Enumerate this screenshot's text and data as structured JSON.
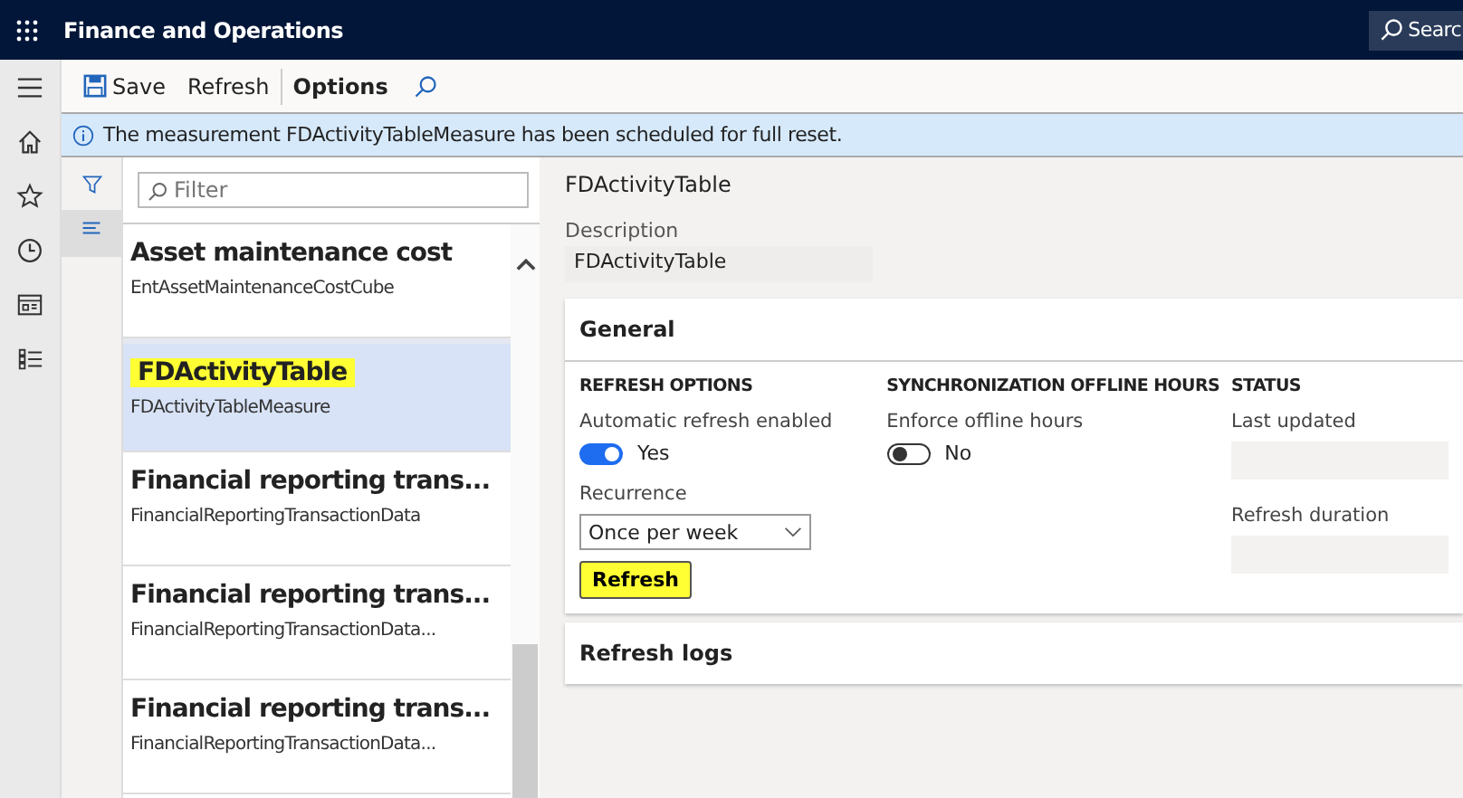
{
  "app": {
    "title": "Finance and Operations",
    "search": "Searc"
  },
  "toolbar": [
    {
      "label": "Save",
      "kind": "save"
    },
    {
      "label": "Refresh",
      "kind": "plain"
    },
    {
      "label": "Options",
      "kind": "bold"
    },
    {
      "kind": "search"
    }
  ],
  "message": {
    "text": "The measurement FDActivityTableMeasure has been scheduled for full reset."
  },
  "filter": {
    "placeholder": "Filter"
  },
  "list": [
    {
      "title": "Asset maintenance cost",
      "subtitle": "EntAssetMaintenanceCostCube",
      "selected": false,
      "highlighted": false
    },
    {
      "title": "FDActivityTable",
      "subtitle": "FDActivityTableMeasure",
      "selected": true,
      "highlighted": true
    },
    {
      "title": "Financial reporting trans...",
      "subtitle": "FinancialReportingTransactionData",
      "selected": false,
      "highlighted": false
    },
    {
      "title": "Financial reporting trans...",
      "subtitle": "FinancialReportingTransactionData...",
      "selected": false,
      "highlighted": false
    },
    {
      "title": "Financial reporting trans...",
      "subtitle": "FinancialReportingTransactionData...",
      "selected": false,
      "highlighted": false
    }
  ],
  "detail": {
    "title": "FDActivityTable",
    "description_label": "Description",
    "description": "FDActivityTable",
    "general": {
      "title": "General",
      "refresh_options": {
        "heading": "REFRESH OPTIONS",
        "toggle_label": "Automatic refresh enabled",
        "on": true,
        "toggle_text": "Yes",
        "recurrence_label": "Recurrence",
        "recurrence": "Once per week",
        "button": "Refresh",
        "button_highlighted": true
      },
      "sync": {
        "heading": "SYNCHRONIZATION OFFLINE HOURS",
        "toggle_label": "Enforce offline hours",
        "on": false,
        "toggle_text": "No"
      },
      "status": {
        "heading": "STATUS",
        "fields": [
          "Last updated",
          "Refresh duration"
        ]
      }
    },
    "logs": {
      "title": "Refresh logs"
    }
  }
}
